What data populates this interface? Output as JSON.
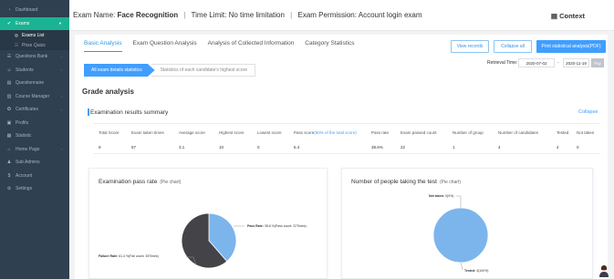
{
  "sidebar": {
    "items": [
      {
        "label": "Dashboard",
        "icon": "dashboard-icon",
        "glyph": "◔",
        "has_chevron": false
      },
      {
        "label": "Exams",
        "icon": "check-circle-icon",
        "glyph": "✔",
        "has_chevron": true,
        "active": true
      },
      {
        "label": "Questions Bank",
        "icon": "list-icon",
        "glyph": "☰",
        "has_chevron": true
      },
      {
        "label": "Students",
        "icon": "user-icon",
        "glyph": "☺",
        "has_chevron": true
      },
      {
        "label": "Questionnaire",
        "icon": "clipboard-icon",
        "glyph": "▤",
        "has_chevron": false
      },
      {
        "label": "Course Manager",
        "icon": "book-icon",
        "glyph": "▥",
        "has_chevron": true
      },
      {
        "label": "Certificates",
        "icon": "certificate-icon",
        "glyph": "✪",
        "has_chevron": true
      },
      {
        "label": "Profits",
        "icon": "money-icon",
        "glyph": "▣",
        "has_chevron": false
      },
      {
        "label": "Statistic",
        "icon": "chart-icon",
        "glyph": "▦",
        "has_chevron": false
      },
      {
        "label": "Home Page",
        "icon": "home-icon",
        "glyph": "⌂",
        "has_chevron": true
      },
      {
        "label": "Sub Admins",
        "icon": "group-icon",
        "glyph": "♟",
        "has_chevron": false
      },
      {
        "label": "Account",
        "icon": "account-icon",
        "glyph": "$",
        "has_chevron": false
      },
      {
        "label": "Settings",
        "icon": "gear-icon",
        "glyph": "⚙",
        "has_chevron": false
      }
    ],
    "exam_subitems": [
      {
        "label": "Exams List",
        "icon": "list-icon",
        "glyph": "◎",
        "selected": true
      },
      {
        "label": "Prize Quizs",
        "icon": "prize-icon",
        "glyph": "☷",
        "selected": false
      }
    ]
  },
  "header": {
    "exam_name_label": "Exam Name:",
    "exam_name": "Face Recognition",
    "time_limit": "Time Limit: No time limitation",
    "permission": "Exam Permission: Account login exam",
    "separator": "|",
    "context_label": "Context",
    "context_icon": "book-icon"
  },
  "tabs": [
    "Basic Analysis",
    "Exam Question Analysis",
    "Analysis of Collected Information",
    "Category Statistics"
  ],
  "buttons": {
    "view_records": "View records",
    "collapse_all": "Collapse all",
    "print": "Print statistical analysis(PDF)"
  },
  "subtabs": {
    "active": "All exam details statistics",
    "inactive": "Statistics of each candidate's highest score"
  },
  "retrieval": {
    "label": "Retrieval Time:",
    "start": "2020-07-02",
    "dash": "-",
    "end": "2020-11-19",
    "pay_label": "Pay"
  },
  "grade_title": "Grade analysis",
  "summary": {
    "title": "Examination results summary",
    "collapse": "Collapse",
    "headers": {
      "total_score": "Total Score",
      "taken_times": "Exam taken times",
      "average": "Average score",
      "highest": "Highest score",
      "lowest": "Lowest score",
      "pass_score": "Pass score",
      "pass_score_note": "(60% of the total score)",
      "pass_rate": "Pass rate",
      "passed_count": "Exam passed count",
      "group_num": "Number of group",
      "candidates": "Number of candidates",
      "tested": "Tested",
      "not_taken": "Not taken"
    },
    "values": {
      "total_score": "9",
      "taken_times": "57",
      "average": "3.1",
      "highest": "10",
      "lowest": "0",
      "pass_score": "5.4",
      "pass_rate": "38.6%",
      "passed_count": "22",
      "group_num": "1",
      "candidates": "4",
      "tested": "4",
      "not_taken": "0"
    }
  },
  "pass_chart": {
    "title": "Examination pass rate",
    "subtitle": "(Pie chart)",
    "pass_label": "Pass Rate:",
    "pass_text": "38.6 %(Pass count: 22Times)",
    "fail_label": "Failure Rate:",
    "fail_text": "61.4 %(Fail count: 35Times)"
  },
  "people_chart": {
    "title": "Number of people taking the test",
    "subtitle": "(Pie chart)",
    "not_taken_label": "Not taken:",
    "not_taken_text": "0(0%)",
    "tested_label": "Tested:",
    "tested_text": "4(100%)"
  },
  "chart_data": [
    {
      "type": "pie",
      "title": "Examination pass rate",
      "subtitle": "(Pie chart)",
      "slices": [
        {
          "name": "Pass Rate",
          "value": 38.6,
          "count": 22,
          "color": "#7cb5ec"
        },
        {
          "name": "Failure Rate",
          "value": 61.4,
          "count": 35,
          "color": "#434348"
        }
      ]
    },
    {
      "type": "pie",
      "title": "Number of people taking the test",
      "subtitle": "(Pie chart)",
      "slices": [
        {
          "name": "Tested",
          "value": 100,
          "count": 4,
          "color": "#7cb5ec"
        },
        {
          "name": "Not taken",
          "value": 0,
          "count": 0,
          "color": "#434348"
        }
      ]
    }
  ],
  "colors": {
    "sidebar_bg": "#2f4050",
    "sidebar_active": "#1ab394",
    "accent": "#409eff"
  }
}
